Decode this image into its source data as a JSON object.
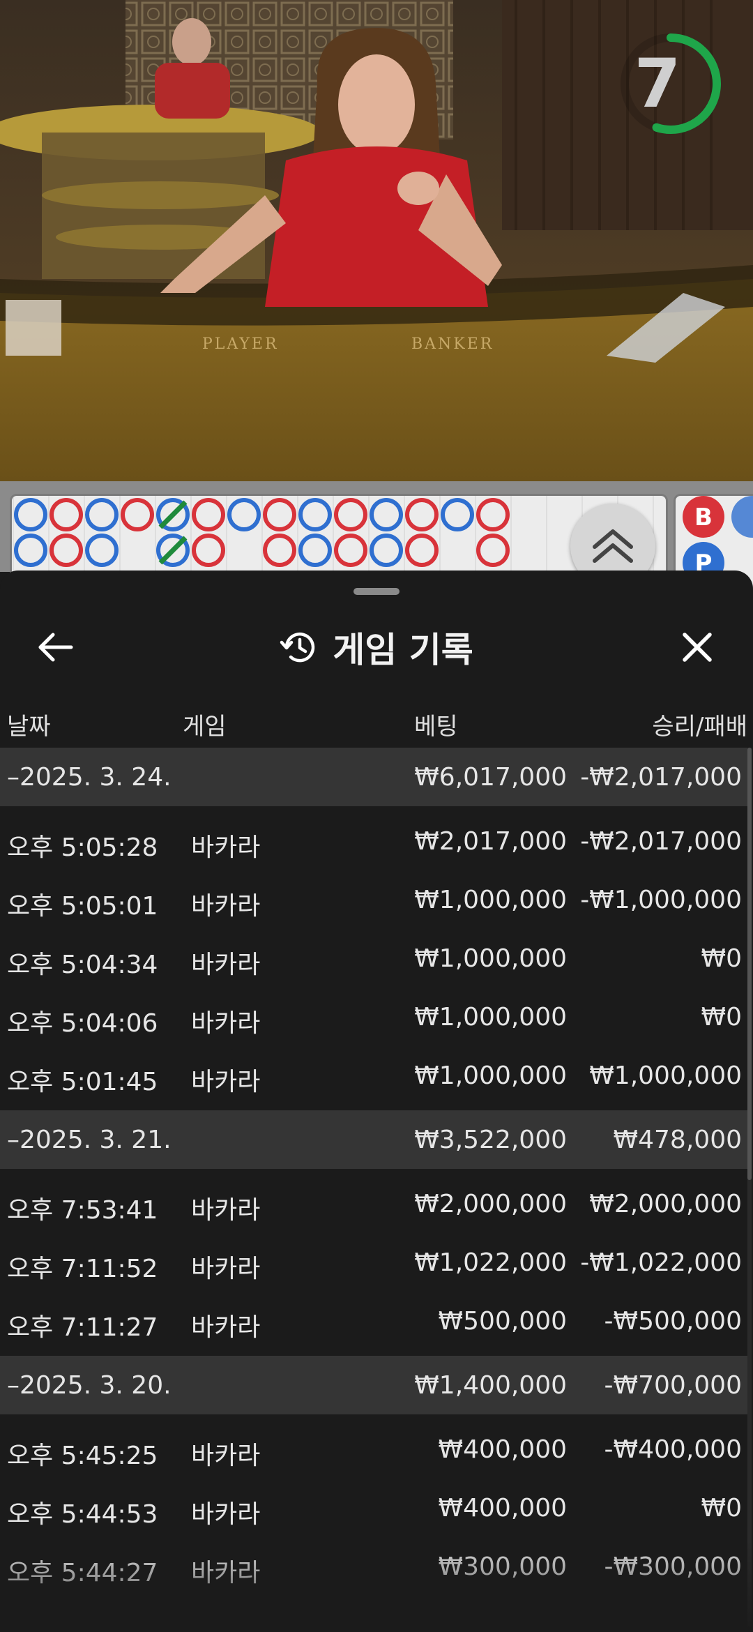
{
  "video": {
    "table_labels": [
      "PLAYER",
      "BANKER"
    ],
    "countdown": "7",
    "countdown_fraction": 0.55
  },
  "roadmap": {
    "rows": [
      [
        "P",
        "B",
        "P",
        "B",
        "T",
        "B",
        "P",
        "B",
        "P",
        "B",
        "P",
        "B",
        "P",
        "B"
      ],
      [
        "P",
        "B",
        "P",
        "",
        "T",
        "B",
        "",
        "B",
        "P",
        "B",
        "P",
        "B",
        "",
        "B"
      ]
    ],
    "side_labels": [
      "B",
      "P"
    ],
    "colors": {
      "player": "#2f6fd0",
      "banker": "#d8333a",
      "tie": "#1f8a3b"
    }
  },
  "sheet": {
    "title": "게임 기록",
    "columns": {
      "date": "날짜",
      "game": "게임",
      "bet": "베팅",
      "result": "승리/패배"
    },
    "groups": [
      {
        "date": "–2025. 3. 24.",
        "bet_total": "₩6,017,000",
        "result_total": "-₩2,017,000",
        "rows": [
          {
            "time": "오후 5:05:28",
            "game": "바카라",
            "bet": "₩2,017,000",
            "result": "-₩2,017,000"
          },
          {
            "time": "오후 5:05:01",
            "game": "바카라",
            "bet": "₩1,000,000",
            "result": "-₩1,000,000"
          },
          {
            "time": "오후 5:04:34",
            "game": "바카라",
            "bet": "₩1,000,000",
            "result": "₩0"
          },
          {
            "time": "오후 5:04:06",
            "game": "바카라",
            "bet": "₩1,000,000",
            "result": "₩0"
          },
          {
            "time": "오후 5:01:45",
            "game": "바카라",
            "bet": "₩1,000,000",
            "result": "₩1,000,000"
          }
        ]
      },
      {
        "date": "–2025. 3. 21.",
        "bet_total": "₩3,522,000",
        "result_total": "₩478,000",
        "rows": [
          {
            "time": "오후 7:53:41",
            "game": "바카라",
            "bet": "₩2,000,000",
            "result": "₩2,000,000"
          },
          {
            "time": "오후 7:11:52",
            "game": "바카라",
            "bet": "₩1,022,000",
            "result": "-₩1,022,000"
          },
          {
            "time": "오후 7:11:27",
            "game": "바카라",
            "bet": "₩500,000",
            "result": "-₩500,000"
          }
        ]
      },
      {
        "date": "–2025. 3. 20.",
        "bet_total": "₩1,400,000",
        "result_total": "-₩700,000",
        "rows": [
          {
            "time": "오후 5:45:25",
            "game": "바카라",
            "bet": "₩400,000",
            "result": "-₩400,000"
          },
          {
            "time": "오후 5:44:53",
            "game": "바카라",
            "bet": "₩400,000",
            "result": "₩0"
          },
          {
            "time": "오후 5:44:27",
            "game": "바카라",
            "bet": "₩300,000",
            "result": "-₩300,000"
          }
        ]
      }
    ]
  }
}
